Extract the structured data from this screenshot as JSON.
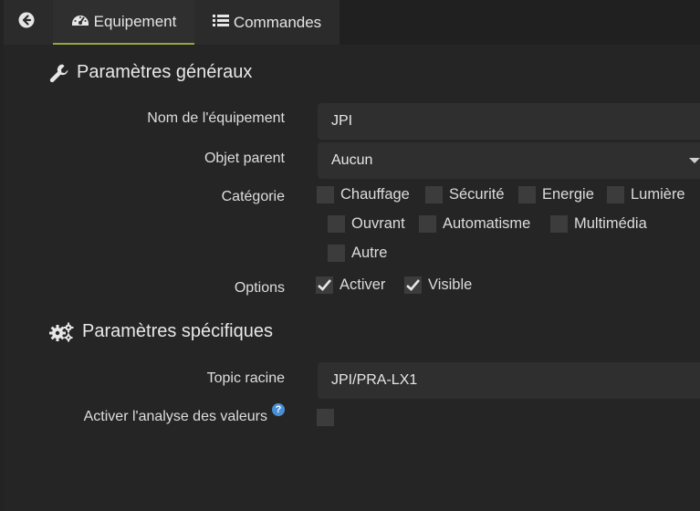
{
  "tabs": {
    "back_icon": "arrow-left-circle-icon",
    "equipement_label": "Equipement",
    "commandes_label": "Commandes",
    "active_color": "#94a83a"
  },
  "general": {
    "title": "Paramètres généraux",
    "name_label": "Nom de l'équipement",
    "name_value": "JPI",
    "parent_label": "Objet parent",
    "parent_value": "Aucun",
    "category_label": "Catégorie",
    "categories": [
      {
        "label": "Chauffage",
        "checked": false
      },
      {
        "label": "Sécurité",
        "checked": false
      },
      {
        "label": "Energie",
        "checked": false
      },
      {
        "label": "Lumière",
        "checked": false
      },
      {
        "label": "Ouvrant",
        "checked": false
      },
      {
        "label": "Automatisme",
        "checked": false
      },
      {
        "label": "Multimédia",
        "checked": false
      },
      {
        "label": "Autre",
        "checked": false
      }
    ],
    "options_label": "Options",
    "options": [
      {
        "label": "Activer",
        "checked": true
      },
      {
        "label": "Visible",
        "checked": true
      }
    ]
  },
  "specific": {
    "title": "Paramètres spécifiques",
    "topic_label": "Topic racine",
    "topic_value": "JPI/PRA-LX1",
    "analyse_label": "Activer l'analyse des valeurs",
    "analyse_help": "?",
    "analyse_checked": false
  }
}
